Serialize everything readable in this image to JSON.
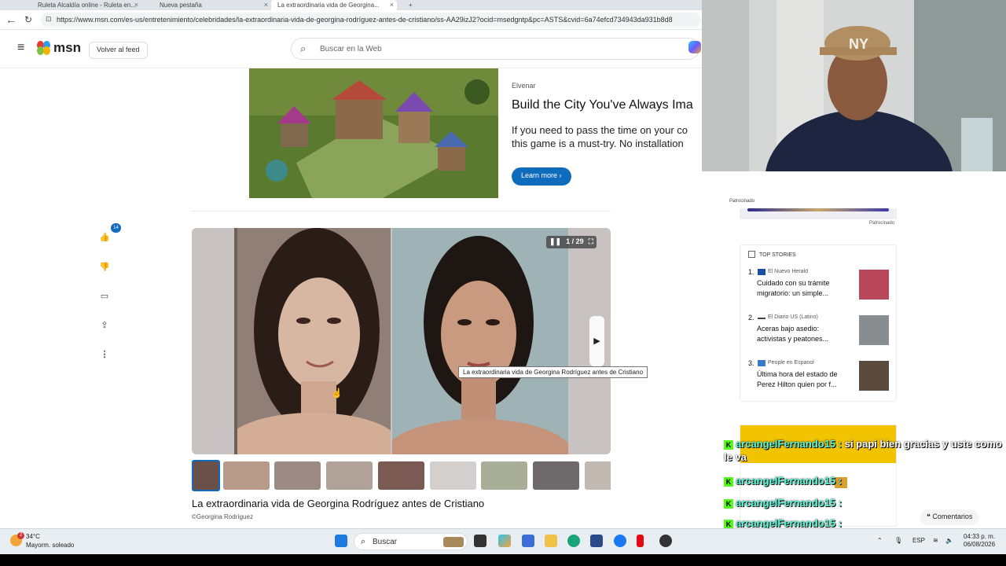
{
  "browser": {
    "tabs": [
      {
        "label": "Ruleta Alcaldía online - Ruleta en..."
      },
      {
        "label": "Nueva pestaña"
      },
      {
        "label": "La extraordinaria vida de Georgina..."
      }
    ],
    "url": "https://www.msn.com/es-us/entretenimiento/celebridades/la-extraordinaria-vida-de-georgina-rodríguez-antes-de-cristiano/ss-AA29izJ2?ocid=msedgntp&pc=ASTS&cvid=6a74efcd734943da931b8d8"
  },
  "header": {
    "logo_text": "msn",
    "feed_button": "Volver al feed",
    "search_placeholder": "Buscar en la Web"
  },
  "ad": {
    "sponsor": "Elvenar",
    "title": "Build the City You've Always Ima",
    "text_line1": "If you need to pass the time on your co",
    "text_line2": "this game is a must-try. No installation",
    "cta": "Learn more"
  },
  "rail": {
    "like_count": "14"
  },
  "gallery": {
    "counter": "1 / 29",
    "tooltip": "La extraordinaria vida de Georgina Rodríguez antes de Cristiano",
    "title": "La extraordinaria vida de Georgina Rodríguez antes de Cristiano",
    "credit": "©Georgina Rodríguez"
  },
  "sidebar": {
    "sponsored": "Patrocinado",
    "sponsored2": "Patrocinado",
    "top_stories_heading": "TOP STORIES",
    "stories": [
      {
        "num": "1.",
        "source": "El Nuevo Herald",
        "headline": "Cuidado con su trámite migratorio: un simple...",
        "src_color": "#1a4fa0",
        "img_color": "#b8475a"
      },
      {
        "num": "2.",
        "source": "El Diario US (Latino)",
        "headline": "Aceras bajo asedio: activistas y peatones...",
        "src_color": "#444444",
        "img_color": "#8a8d8f"
      },
      {
        "num": "3.",
        "source": "People en Espanol",
        "headline": "Última hora del estado de Perez Hilton quien por f...",
        "src_color": "#3a7ac4",
        "img_color": "#5a4b3c"
      }
    ],
    "comments": "Comentarios"
  },
  "chat": [
    {
      "user": "arcangelFernando15",
      "msg": "si papi bien gracias y uste como le va"
    },
    {
      "user": "arcangelFernando15",
      "msg": ""
    },
    {
      "user": "arcangelFernando15",
      "msg": ""
    },
    {
      "user": "arcangelFernando15",
      "msg": ""
    }
  ],
  "taskbar": {
    "temp": "34°C",
    "weather": "Mayorm. soleado",
    "weather_badge": "2",
    "search": "Buscar",
    "lang": "ESP",
    "time": "04:33 p. m.",
    "date": "06/08/2026"
  }
}
